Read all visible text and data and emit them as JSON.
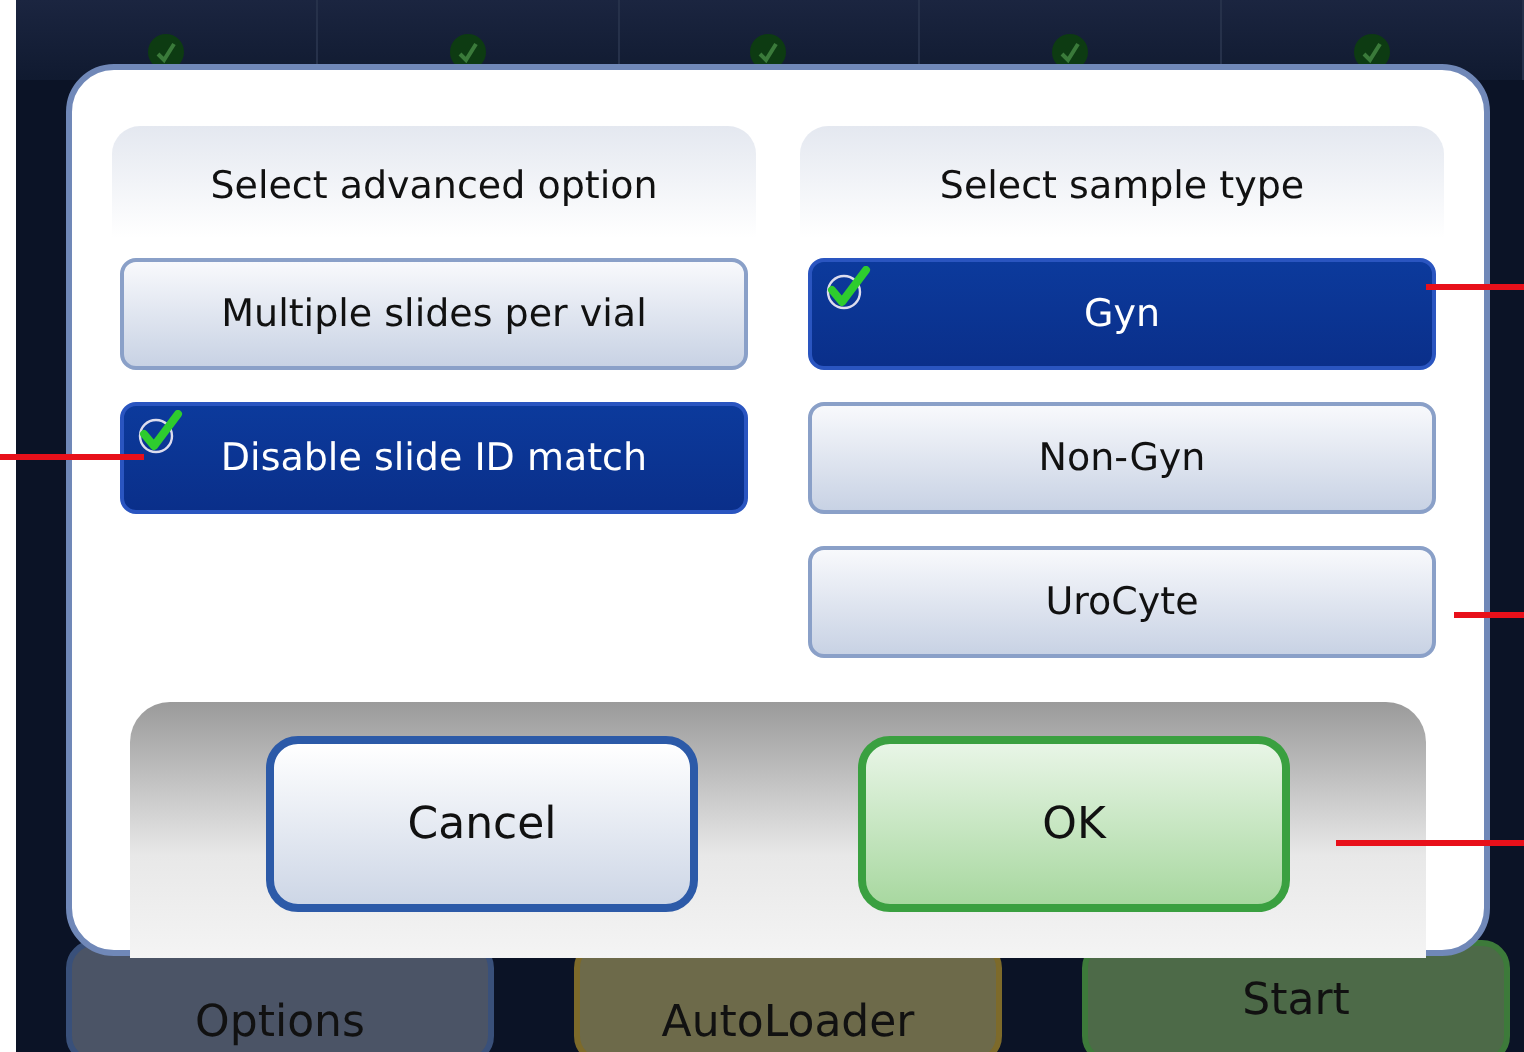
{
  "dialog": {
    "advanced": {
      "title": "Select advanced option",
      "options": [
        {
          "label": "Multiple slides per vial",
          "selected": false
        },
        {
          "label": "Disable slide ID match",
          "selected": true
        }
      ]
    },
    "sample_type": {
      "title": "Select sample type",
      "options": [
        {
          "label": "Gyn",
          "selected": true
        },
        {
          "label": "Non-Gyn",
          "selected": false
        },
        {
          "label": "UroCyte",
          "selected": false
        }
      ]
    },
    "buttons": [
      {
        "label": "Cancel",
        "kind": "cancel"
      },
      {
        "label": "OK",
        "kind": "ok"
      }
    ]
  },
  "background_buttons": [
    {
      "label": "Options",
      "kind": "options"
    },
    {
      "label": "AutoLoader",
      "kind": "autoloader"
    },
    {
      "label": "Start",
      "kind": "start"
    }
  ]
}
